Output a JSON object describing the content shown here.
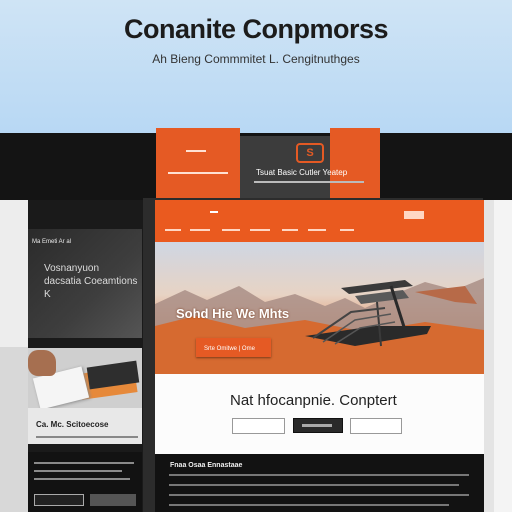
{
  "banner": {
    "title": "Conanite Conpmorss",
    "subtitle": "Ah Bieng Commmitet L. Cengitnuthges"
  },
  "header_mock": {
    "logo_glyph": "S",
    "tagline": "Tsuat Basic Cutler Yeatep"
  },
  "left_card": {
    "top_line": "Ma Emeti Ar al",
    "text": "Vosnanyuon dacsatia Coeamtions K"
  },
  "side_caption": {
    "text": "Ca. Mc. Scitoecose"
  },
  "hero": {
    "title": "Sohd Hie We Mhts",
    "button_label": "Srte Omitwe | Ome"
  },
  "content": {
    "title": "Nat hfocanpnie. Conptert"
  },
  "footer": {
    "title": "Fnaa Osaa Ennastaae"
  },
  "colors": {
    "accent": "#e55a24",
    "dark": "#141414",
    "banner": "#b8d8f4"
  }
}
